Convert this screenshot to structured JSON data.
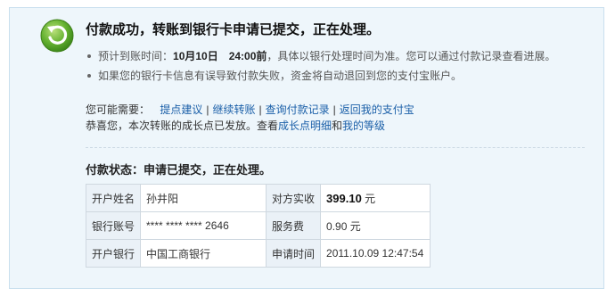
{
  "headline": "付款成功，转账到银行卡申请已提交，正在处理。",
  "bullets": {
    "b1_prefix": "预计到账时间：",
    "b1_time": "10月10日　24:00前",
    "b1_suffix": "，具体以银行处理时间为准。您可以通过付款记录查看进展。",
    "b2": "如果您的银行卡信息有误导致付款失败，资金将自动退回到您的支付宝账户。"
  },
  "needs": {
    "label": "您可能需要：",
    "links": [
      "提点建议",
      "继续转账",
      "查询付款记录",
      "返回我的支付宝"
    ],
    "separator": "|"
  },
  "congrats": {
    "prefix": "恭喜您，本次转账的成长点已发放。查看",
    "link1": "成长点明细",
    "mid": "和",
    "link2": "我的等级"
  },
  "status": "付款状态：申请已提交，正在处理。",
  "table": {
    "r1": {
      "l1": "开户姓名",
      "v1": "孙井阳",
      "l2": "对方实收",
      "v2_amount": "399.10",
      "v2_unit": " 元"
    },
    "r2": {
      "l1": "银行账号",
      "v1": "**** **** **** 2646",
      "l2": "服务费",
      "v2": "0.90 元"
    },
    "r3": {
      "l1": "开户银行",
      "v1": "中国工商银行",
      "l2": "申请时间",
      "v2": "2011.10.09 12:47:54"
    }
  },
  "colors": {
    "icon_green": "#5aa82b",
    "link": "#1a5fa8",
    "panel_bg": "#eef6fb"
  },
  "icons": {
    "success": "refresh-arrow-icon"
  }
}
